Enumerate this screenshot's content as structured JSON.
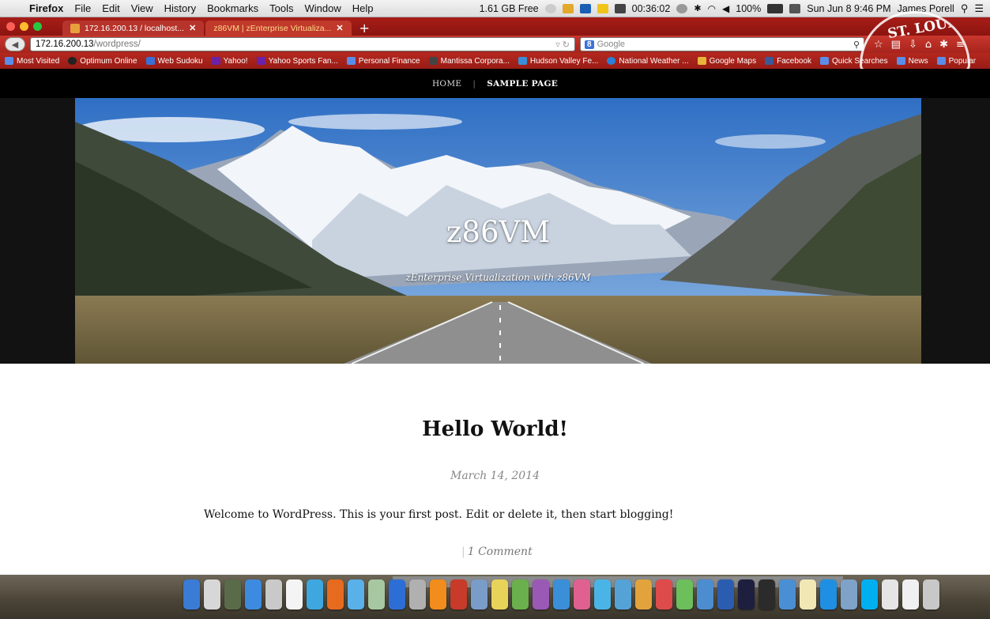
{
  "menubar": {
    "app_name": "Firefox",
    "menus": [
      "File",
      "Edit",
      "View",
      "History",
      "Bookmarks",
      "Tools",
      "Window",
      "Help"
    ],
    "disk_free": "1.61 GB Free",
    "timer": "00:36:02",
    "battery": "100%",
    "datetime": "Sun Jun 8  9:46 PM",
    "user": "James Porell"
  },
  "tabs": [
    {
      "label": "172.16.200.13 / localhost...",
      "active": true
    },
    {
      "label": "z86VM | zEnterprise Virtualiza...",
      "active": false
    }
  ],
  "navbar": {
    "url_host": "172.16.200.13",
    "url_path": "/wordpress/",
    "search_placeholder": "Google"
  },
  "bookmarks": [
    {
      "label": "Most Visited",
      "icon": "folder-icon",
      "color": "#5b8de8"
    },
    {
      "label": "Optimum Online",
      "icon": "optimum-icon",
      "color": "#222222"
    },
    {
      "label": "Web Sudoku",
      "icon": "grid-icon",
      "color": "#3a6fd8"
    },
    {
      "label": "Yahoo!",
      "icon": "yahoo-icon",
      "color": "#6b21a8"
    },
    {
      "label": "Yahoo Sports Fan...",
      "icon": "yahoo-icon",
      "color": "#6b21a8"
    },
    {
      "label": "Personal Finance",
      "icon": "folder-icon",
      "color": "#5b8de8"
    },
    {
      "label": "Mantissa Corpora...",
      "icon": "page-icon",
      "color": "#444444"
    },
    {
      "label": "Hudson Valley Fe...",
      "icon": "photo-icon",
      "color": "#3a8dd8"
    },
    {
      "label": "National Weather ...",
      "icon": "weather-icon",
      "color": "#2a7fd8"
    },
    {
      "label": "Google Maps",
      "icon": "maps-icon",
      "color": "#e8b53a"
    },
    {
      "label": "Facebook",
      "icon": "facebook-icon",
      "color": "#3b5998"
    },
    {
      "label": "Quick Searches",
      "icon": "folder-icon",
      "color": "#5b8de8"
    },
    {
      "label": "News",
      "icon": "folder-icon",
      "color": "#5b8de8"
    },
    {
      "label": "Popular",
      "icon": "folder-icon",
      "color": "#5b8de8"
    }
  ],
  "logo_text": "ST. LOUIS",
  "site": {
    "nav": [
      "HOME",
      "SAMPLE PAGE"
    ],
    "title": "z86VM",
    "description": "zEnterprise Virtualization with z86VM"
  },
  "post": {
    "title": "Hello World!",
    "date": "March 14, 2014",
    "body": "Welcome to WordPress. This is your first post. Edit or delete it, then start blogging!",
    "comments": "1 Comment"
  },
  "colors": {
    "browser_theme": "#b3281f",
    "site_nav_bg": "#000000",
    "hero_frame": "#121212"
  }
}
